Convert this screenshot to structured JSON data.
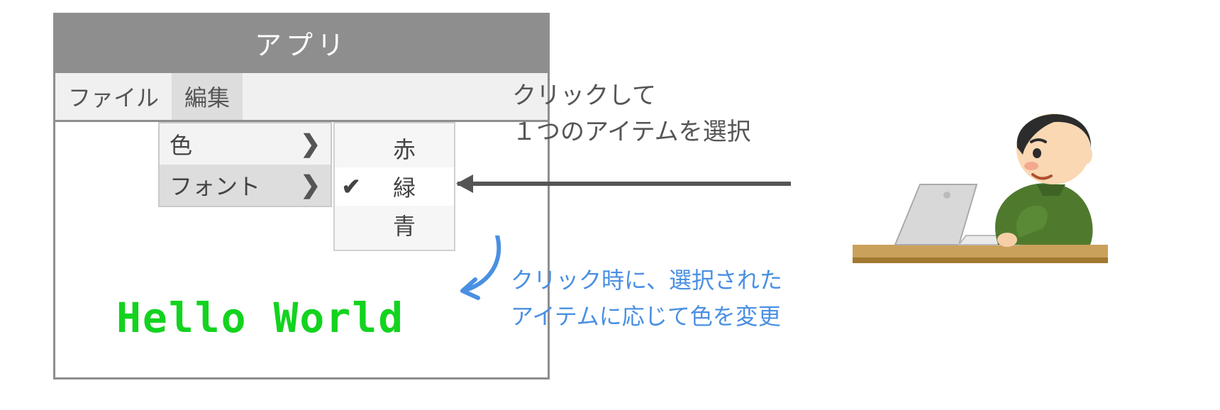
{
  "app": {
    "title": "アプリ",
    "menubar": {
      "file": "ファイル",
      "edit": "編集"
    },
    "dropdown": {
      "color": "色",
      "font": "フォント",
      "arrow": "❯",
      "colors": {
        "red": "赤",
        "green": "緑",
        "blue": "青",
        "check": "✔"
      }
    },
    "content_text": "Hello World"
  },
  "annotations": {
    "click_line1": "クリックして",
    "click_line2": "１つのアイテムを選択",
    "effect_line1": "クリック時に、選択された",
    "effect_line2": "アイテムに応じて色を変更"
  },
  "colors": {
    "accent_green": "#13d31f",
    "link_blue": "#4a90e2"
  }
}
